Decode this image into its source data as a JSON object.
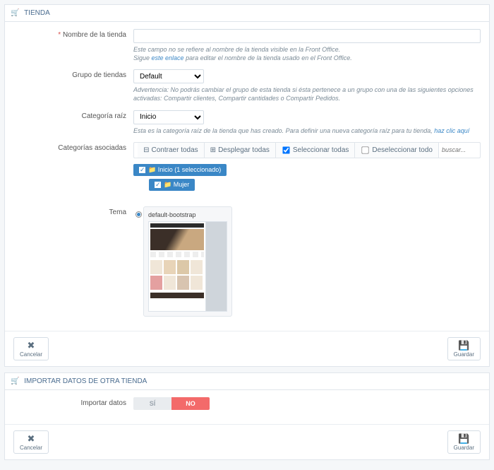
{
  "panel1": {
    "title": "TIENDA",
    "icon": "🛒",
    "fields": {
      "name": {
        "label": "Nombre de la tienda",
        "required": true,
        "help1": "Este campo no se refiere al nombre de la tienda visible en la Front Office.",
        "help2a": "Sigue ",
        "help2link": "este enlace",
        "help2b": " para editar el nombre de la tienda usado en el Front Office."
      },
      "group": {
        "label": "Grupo de tiendas",
        "value": "Default",
        "help": "Advertencia: No podrás cambiar el grupo de esta tienda si ésta pertenece a un grupo con una de las siguientes opciones activadas: Compartir clientes, Compartir cantidades o Compartir Pedidos."
      },
      "rootcat": {
        "label": "Categoría raíz",
        "value": "Inicio",
        "help1": "Esta es la categoría raíz de la tienda que has creado. Para definir una nueva categoría raíz para tu tienda, ",
        "helplink": "haz clic aquí"
      },
      "assoc": {
        "label": "Categorías asociadas",
        "toolbar": {
          "collapse": "Contraer todas",
          "expand": "Desplegar todas",
          "checkall": "Seleccionar todas",
          "uncheck": "Deseleccionar todo",
          "search_ph": "buscar..."
        },
        "tree": {
          "root": "Inicio (1 seleccionado)",
          "child": "Mujer"
        }
      },
      "theme": {
        "label": "Tema",
        "name": "default-bootstrap"
      }
    }
  },
  "panel2": {
    "title": "IMPORTAR DATOS DE OTRA TIENDA",
    "icon": "🛒",
    "import": {
      "label": "Importar datos",
      "yes": "SÍ",
      "no": "NO"
    }
  },
  "buttons": {
    "cancel": "Cancelar",
    "save": "Guardar"
  }
}
